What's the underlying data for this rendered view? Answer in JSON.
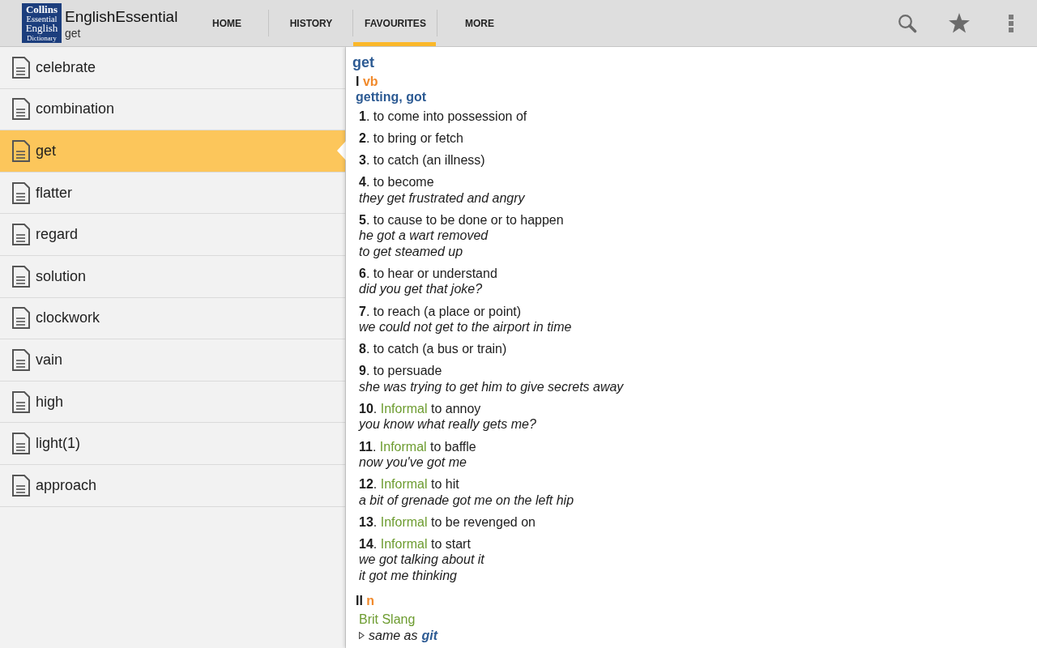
{
  "app_bar": {
    "logo": {
      "lines": [
        "Collins",
        "Essential",
        "English",
        "Dictionary"
      ]
    },
    "title": "EnglishEssential",
    "subtitle": "get",
    "tabs": [
      {
        "label": "HOME",
        "selected": false
      },
      {
        "label": "HISTORY",
        "selected": false
      },
      {
        "label": "FAVOURITES",
        "selected": true
      },
      {
        "label": "MORE",
        "selected": false
      }
    ]
  },
  "favourites": {
    "items": [
      {
        "word": "celebrate",
        "selected": false
      },
      {
        "word": "combination",
        "selected": false
      },
      {
        "word": "get",
        "selected": true
      },
      {
        "word": "flatter",
        "selected": false
      },
      {
        "word": "regard",
        "selected": false
      },
      {
        "word": "solution",
        "selected": false
      },
      {
        "word": "clockwork",
        "selected": false
      },
      {
        "word": "vain",
        "selected": false
      },
      {
        "word": "high",
        "selected": false
      },
      {
        "word": "light(1)",
        "selected": false
      },
      {
        "word": "approach",
        "selected": false
      }
    ]
  },
  "entry": {
    "headword": "get",
    "sections": [
      {
        "numeral": "I",
        "pos": "vb",
        "forms": "getting, got",
        "senses": [
          {
            "kind": "numbered",
            "number": "**1**.",
            "definition": "to come into possession of"
          },
          {
            "kind": "numbered",
            "number": "**2**.",
            "definition": "to bring or fetch"
          },
          {
            "kind": "numbered",
            "number": "**3**.",
            "definition": "to catch (an illness)"
          },
          {
            "kind": "numbered",
            "number": "**4**.",
            "definition": "to become",
            "examples": [
              "they get frustrated and angry"
            ]
          },
          {
            "kind": "numbered",
            "number": "**5**.",
            "definition": "to cause to be done or to happen",
            "examples": [
              "he got a wart removed",
              "to get steamed up"
            ]
          },
          {
            "kind": "numbered",
            "number": "**6**.",
            "definition": "to hear or understand",
            "examples": [
              "did you get that joke?"
            ]
          },
          {
            "kind": "numbered",
            "number": "**7**.",
            "definition": "to reach (a place or point)",
            "examples": [
              "we could not get to the airport in time"
            ]
          },
          {
            "kind": "numbered",
            "number": "**8**.",
            "definition": "to catch (a bus or train)"
          },
          {
            "kind": "numbered",
            "number": "**9**.",
            "definition": "to persuade",
            "examples": [
              "she was trying to get him to give secrets away"
            ]
          },
          {
            "kind": "numbered",
            "number": "**10**.",
            "label": "Informal",
            "definition": "to annoy",
            "examples": [
              "you know what really gets me?"
            ]
          },
          {
            "kind": "numbered",
            "number": "**11**.",
            "label": "Informal",
            "definition": "to baffle",
            "examples": [
              "now you've got me"
            ]
          },
          {
            "kind": "numbered",
            "number": "**12**.",
            "label": "Informal",
            "definition": "to hit",
            "examples": [
              "a bit of grenade got me on the left hip"
            ]
          },
          {
            "kind": "numbered",
            "number": "**13**.",
            "label": "Informal",
            "definition": "to be revenged on"
          },
          {
            "kind": "numbered",
            "number": "**14**.",
            "label": "Informal",
            "definition": "to start",
            "examples": [
              "we got talking about it",
              "it got me thinking"
            ]
          }
        ]
      },
      {
        "numeral": "II",
        "pos": "n",
        "senses": [
          {
            "kind": "crossref",
            "label": "Brit Slang",
            "text": "same as",
            "target": "git"
          }
        ]
      }
    ]
  }
}
